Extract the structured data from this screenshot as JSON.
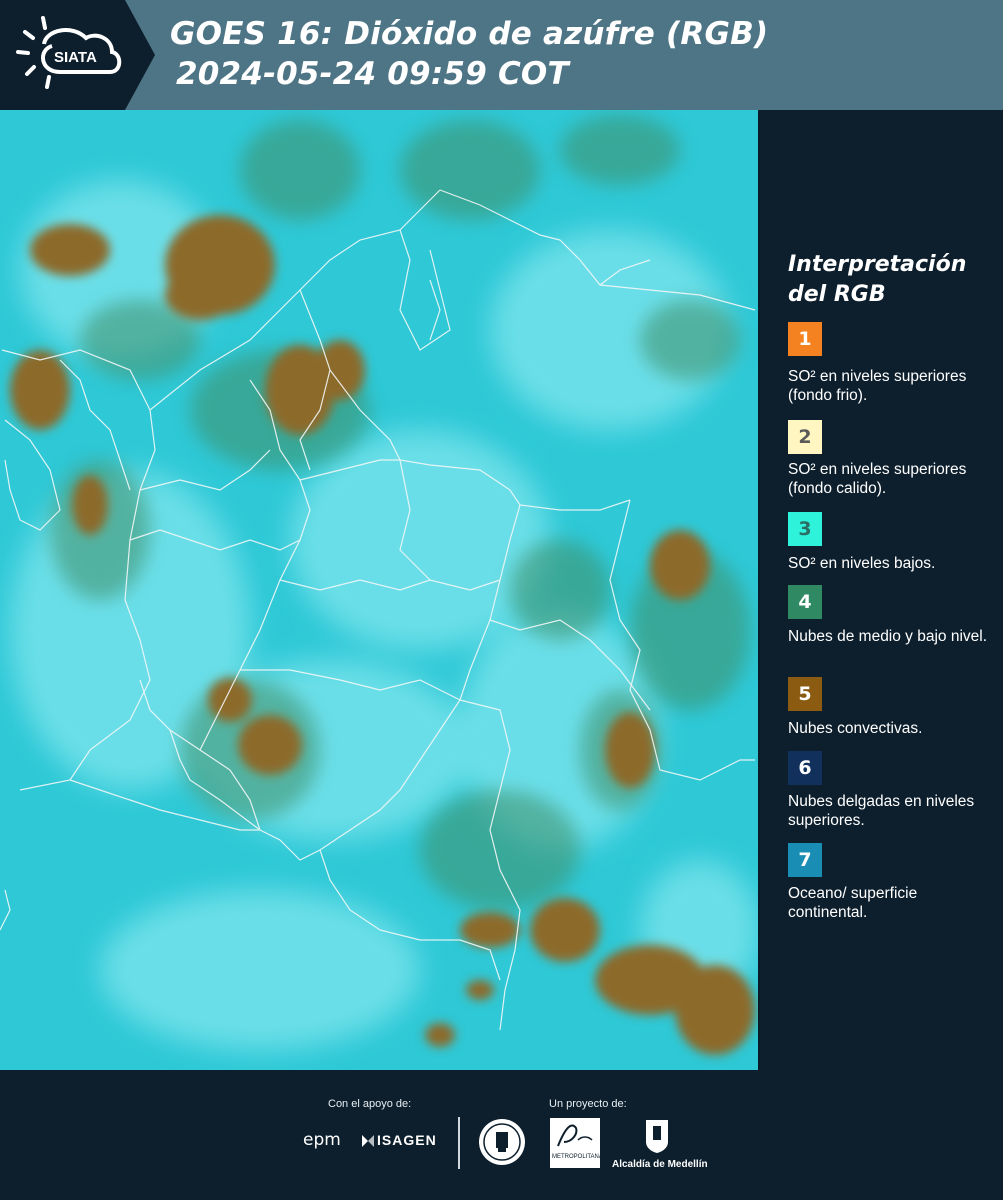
{
  "header": {
    "logo_text": "SIATA",
    "title_line1": "GOES 16: Dióxido de azúfre (RGB)",
    "title_line2": "2024-05-24 09:59 COT"
  },
  "legend": {
    "title": "Interpretación del RGB",
    "items": [
      {
        "number": "1",
        "color": "#f58220",
        "text_color": "#ffffff",
        "text": "SO² en niveles superiores (fondo frio)."
      },
      {
        "number": "2",
        "color": "#fff6c2",
        "text_color": "#5a5a5a",
        "text": "SO² en niveles superiores (fondo calido)."
      },
      {
        "number": "3",
        "color": "#2ef2d9",
        "text_color": "#2a6e66",
        "text": "SO² en niveles bajos."
      },
      {
        "number": "4",
        "color": "#2f8a63",
        "text_color": "#ffffff",
        "text": "Nubes de medio y bajo nivel."
      },
      {
        "number": "5",
        "color": "#8c5b12",
        "text_color": "#ffffff",
        "text": "Nubes convectivas."
      },
      {
        "number": "6",
        "color": "#12305c",
        "text_color": "#ffffff",
        "text": "Nubes delgadas en niveles superiores."
      },
      {
        "number": "7",
        "color": "#1a8db5",
        "text_color": "#ffffff",
        "text": "Oceano/ superficie continental."
      }
    ]
  },
  "footer": {
    "support_label": "Con el apoyo de:",
    "project_label": "Un proyecto de:",
    "epm_text": "epm",
    "isagen_text": "ISAGEN",
    "metropolitana_text": "METROPOLITANA",
    "alcaldia_text": "Alcaldía de Medellín"
  },
  "colors": {
    "header_bg": "#4e7585",
    "page_bg": "#0d1f2d",
    "map_ocean": "#29c9d8",
    "cloud_brown": "#8a6a2a"
  }
}
